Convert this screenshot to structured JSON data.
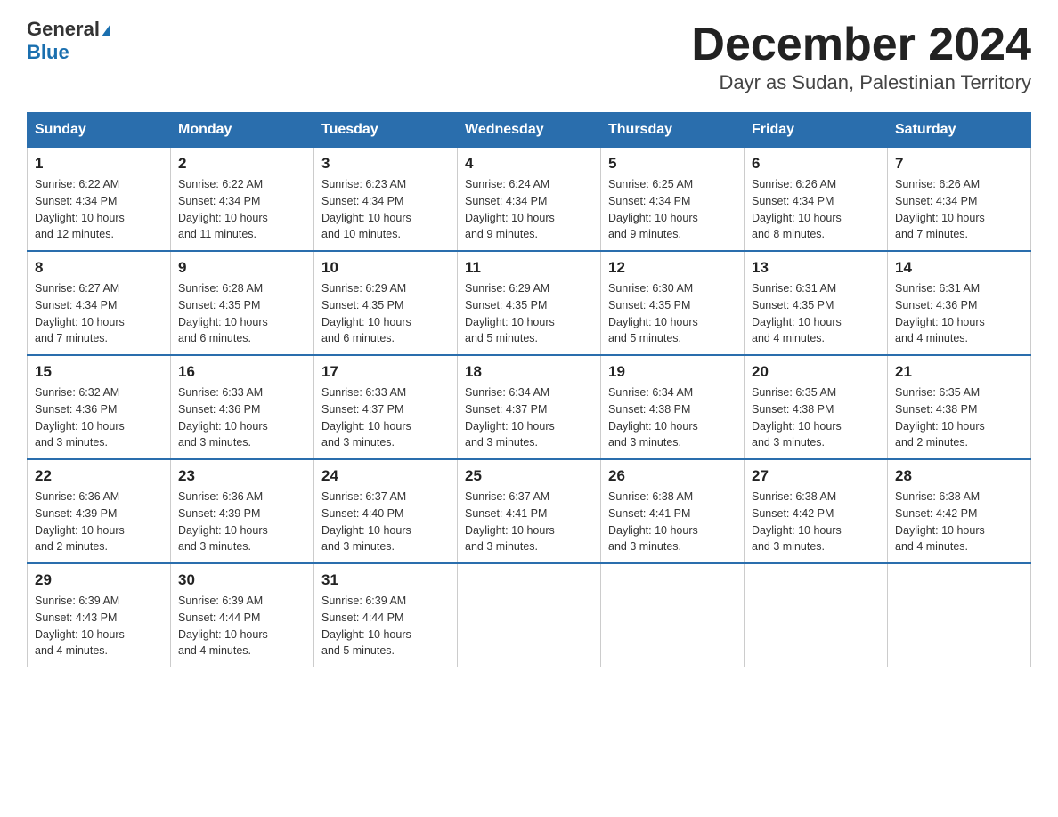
{
  "header": {
    "logo_general": "General",
    "logo_blue": "Blue",
    "month_title": "December 2024",
    "location": "Dayr as Sudan, Palestinian Territory"
  },
  "days_of_week": [
    "Sunday",
    "Monday",
    "Tuesday",
    "Wednesday",
    "Thursday",
    "Friday",
    "Saturday"
  ],
  "weeks": [
    [
      {
        "day": "1",
        "sunrise": "6:22 AM",
        "sunset": "4:34 PM",
        "daylight": "10 hours and 12 minutes."
      },
      {
        "day": "2",
        "sunrise": "6:22 AM",
        "sunset": "4:34 PM",
        "daylight": "10 hours and 11 minutes."
      },
      {
        "day": "3",
        "sunrise": "6:23 AM",
        "sunset": "4:34 PM",
        "daylight": "10 hours and 10 minutes."
      },
      {
        "day": "4",
        "sunrise": "6:24 AM",
        "sunset": "4:34 PM",
        "daylight": "10 hours and 9 minutes."
      },
      {
        "day": "5",
        "sunrise": "6:25 AM",
        "sunset": "4:34 PM",
        "daylight": "10 hours and 9 minutes."
      },
      {
        "day": "6",
        "sunrise": "6:26 AM",
        "sunset": "4:34 PM",
        "daylight": "10 hours and 8 minutes."
      },
      {
        "day": "7",
        "sunrise": "6:26 AM",
        "sunset": "4:34 PM",
        "daylight": "10 hours and 7 minutes."
      }
    ],
    [
      {
        "day": "8",
        "sunrise": "6:27 AM",
        "sunset": "4:34 PM",
        "daylight": "10 hours and 7 minutes."
      },
      {
        "day": "9",
        "sunrise": "6:28 AM",
        "sunset": "4:35 PM",
        "daylight": "10 hours and 6 minutes."
      },
      {
        "day": "10",
        "sunrise": "6:29 AM",
        "sunset": "4:35 PM",
        "daylight": "10 hours and 6 minutes."
      },
      {
        "day": "11",
        "sunrise": "6:29 AM",
        "sunset": "4:35 PM",
        "daylight": "10 hours and 5 minutes."
      },
      {
        "day": "12",
        "sunrise": "6:30 AM",
        "sunset": "4:35 PM",
        "daylight": "10 hours and 5 minutes."
      },
      {
        "day": "13",
        "sunrise": "6:31 AM",
        "sunset": "4:35 PM",
        "daylight": "10 hours and 4 minutes."
      },
      {
        "day": "14",
        "sunrise": "6:31 AM",
        "sunset": "4:36 PM",
        "daylight": "10 hours and 4 minutes."
      }
    ],
    [
      {
        "day": "15",
        "sunrise": "6:32 AM",
        "sunset": "4:36 PM",
        "daylight": "10 hours and 3 minutes."
      },
      {
        "day": "16",
        "sunrise": "6:33 AM",
        "sunset": "4:36 PM",
        "daylight": "10 hours and 3 minutes."
      },
      {
        "day": "17",
        "sunrise": "6:33 AM",
        "sunset": "4:37 PM",
        "daylight": "10 hours and 3 minutes."
      },
      {
        "day": "18",
        "sunrise": "6:34 AM",
        "sunset": "4:37 PM",
        "daylight": "10 hours and 3 minutes."
      },
      {
        "day": "19",
        "sunrise": "6:34 AM",
        "sunset": "4:38 PM",
        "daylight": "10 hours and 3 minutes."
      },
      {
        "day": "20",
        "sunrise": "6:35 AM",
        "sunset": "4:38 PM",
        "daylight": "10 hours and 3 minutes."
      },
      {
        "day": "21",
        "sunrise": "6:35 AM",
        "sunset": "4:38 PM",
        "daylight": "10 hours and 2 minutes."
      }
    ],
    [
      {
        "day": "22",
        "sunrise": "6:36 AM",
        "sunset": "4:39 PM",
        "daylight": "10 hours and 2 minutes."
      },
      {
        "day": "23",
        "sunrise": "6:36 AM",
        "sunset": "4:39 PM",
        "daylight": "10 hours and 3 minutes."
      },
      {
        "day": "24",
        "sunrise": "6:37 AM",
        "sunset": "4:40 PM",
        "daylight": "10 hours and 3 minutes."
      },
      {
        "day": "25",
        "sunrise": "6:37 AM",
        "sunset": "4:41 PM",
        "daylight": "10 hours and 3 minutes."
      },
      {
        "day": "26",
        "sunrise": "6:38 AM",
        "sunset": "4:41 PM",
        "daylight": "10 hours and 3 minutes."
      },
      {
        "day": "27",
        "sunrise": "6:38 AM",
        "sunset": "4:42 PM",
        "daylight": "10 hours and 3 minutes."
      },
      {
        "day": "28",
        "sunrise": "6:38 AM",
        "sunset": "4:42 PM",
        "daylight": "10 hours and 4 minutes."
      }
    ],
    [
      {
        "day": "29",
        "sunrise": "6:39 AM",
        "sunset": "4:43 PM",
        "daylight": "10 hours and 4 minutes."
      },
      {
        "day": "30",
        "sunrise": "6:39 AM",
        "sunset": "4:44 PM",
        "daylight": "10 hours and 4 minutes."
      },
      {
        "day": "31",
        "sunrise": "6:39 AM",
        "sunset": "4:44 PM",
        "daylight": "10 hours and 5 minutes."
      },
      null,
      null,
      null,
      null
    ]
  ],
  "labels": {
    "sunrise": "Sunrise:",
    "sunset": "Sunset:",
    "daylight": "Daylight:"
  }
}
